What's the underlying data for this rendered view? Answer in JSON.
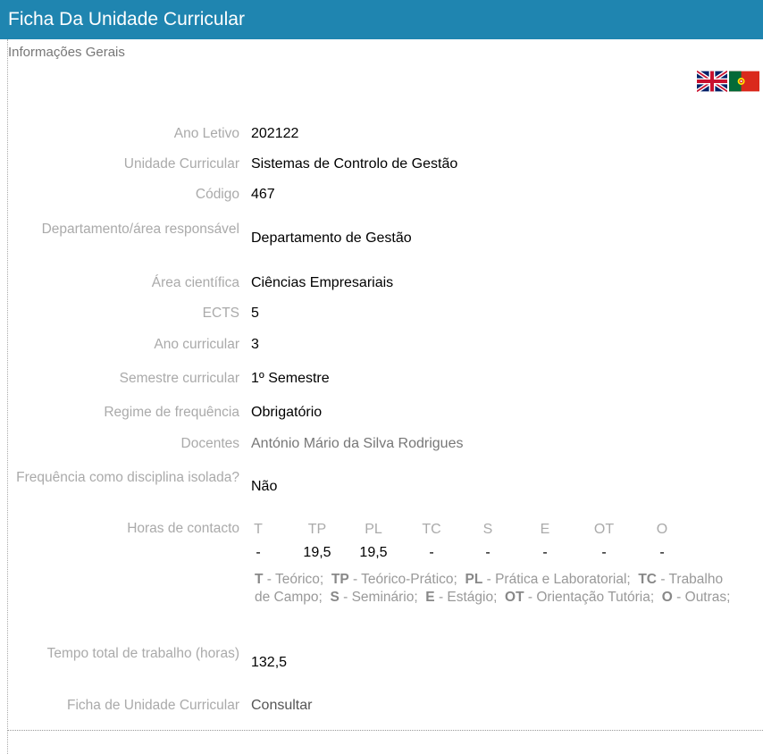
{
  "header": {
    "title": "Ficha Da Unidade Curricular",
    "subtitle": "Informações Gerais"
  },
  "flags": [
    {
      "icon": "uk-flag-icon"
    },
    {
      "icon": "portugal-flag-icon"
    }
  ],
  "fields": {
    "ano_letivo": {
      "label": "Ano Letivo",
      "value": "202122"
    },
    "unidade": {
      "label": "Unidade Curricular",
      "value": "Sistemas de Controlo de Gestão"
    },
    "codigo": {
      "label": "Código",
      "value": "467"
    },
    "departamento": {
      "label": "Departamento/área responsável",
      "value": "Departamento de Gestão"
    },
    "area": {
      "label": "Área científica",
      "value": "Ciências Empresariais"
    },
    "ects": {
      "label": "ECTS",
      "value": "5"
    },
    "ano_curricular": {
      "label": "Ano curricular",
      "value": "3"
    },
    "semestre": {
      "label": "Semestre curricular",
      "value": "1º Semestre"
    },
    "regime": {
      "label": "Regime de frequência",
      "value": "Obrigatório"
    },
    "docentes": {
      "label": "Docentes",
      "value": "António Mário da Silva Rodrigues"
    },
    "isolada": {
      "label": "Frequência como disciplina isolada?",
      "value": "Não"
    },
    "horas": {
      "label": "Horas de contacto"
    },
    "tempo_total": {
      "label": "Tempo total de trabalho (horas)",
      "value": "132,5"
    },
    "ficha": {
      "label": "Ficha de Unidade Curricular",
      "value": "Consultar"
    }
  },
  "hours": {
    "headers": [
      "T",
      "TP",
      "PL",
      "TC",
      "S",
      "E",
      "OT",
      "O"
    ],
    "values": [
      "-",
      "19,5",
      "19,5",
      "-",
      "-",
      "-",
      "-",
      "-"
    ]
  },
  "legend": [
    {
      "abbr": "T",
      "text": " - Teórico;"
    },
    {
      "abbr": "TP",
      "text": " - Teórico-Prático;"
    },
    {
      "abbr": "PL",
      "text": " - Prática e Laboratorial;"
    },
    {
      "abbr": "TC",
      "text": " - Trabalho de Campo;"
    },
    {
      "abbr": "S",
      "text": " - Seminário;"
    },
    {
      "abbr": "E",
      "text": " - Estágio;"
    },
    {
      "abbr": "OT",
      "text": " - Orientação Tutória;"
    },
    {
      "abbr": "O",
      "text": " - Outras;"
    }
  ]
}
